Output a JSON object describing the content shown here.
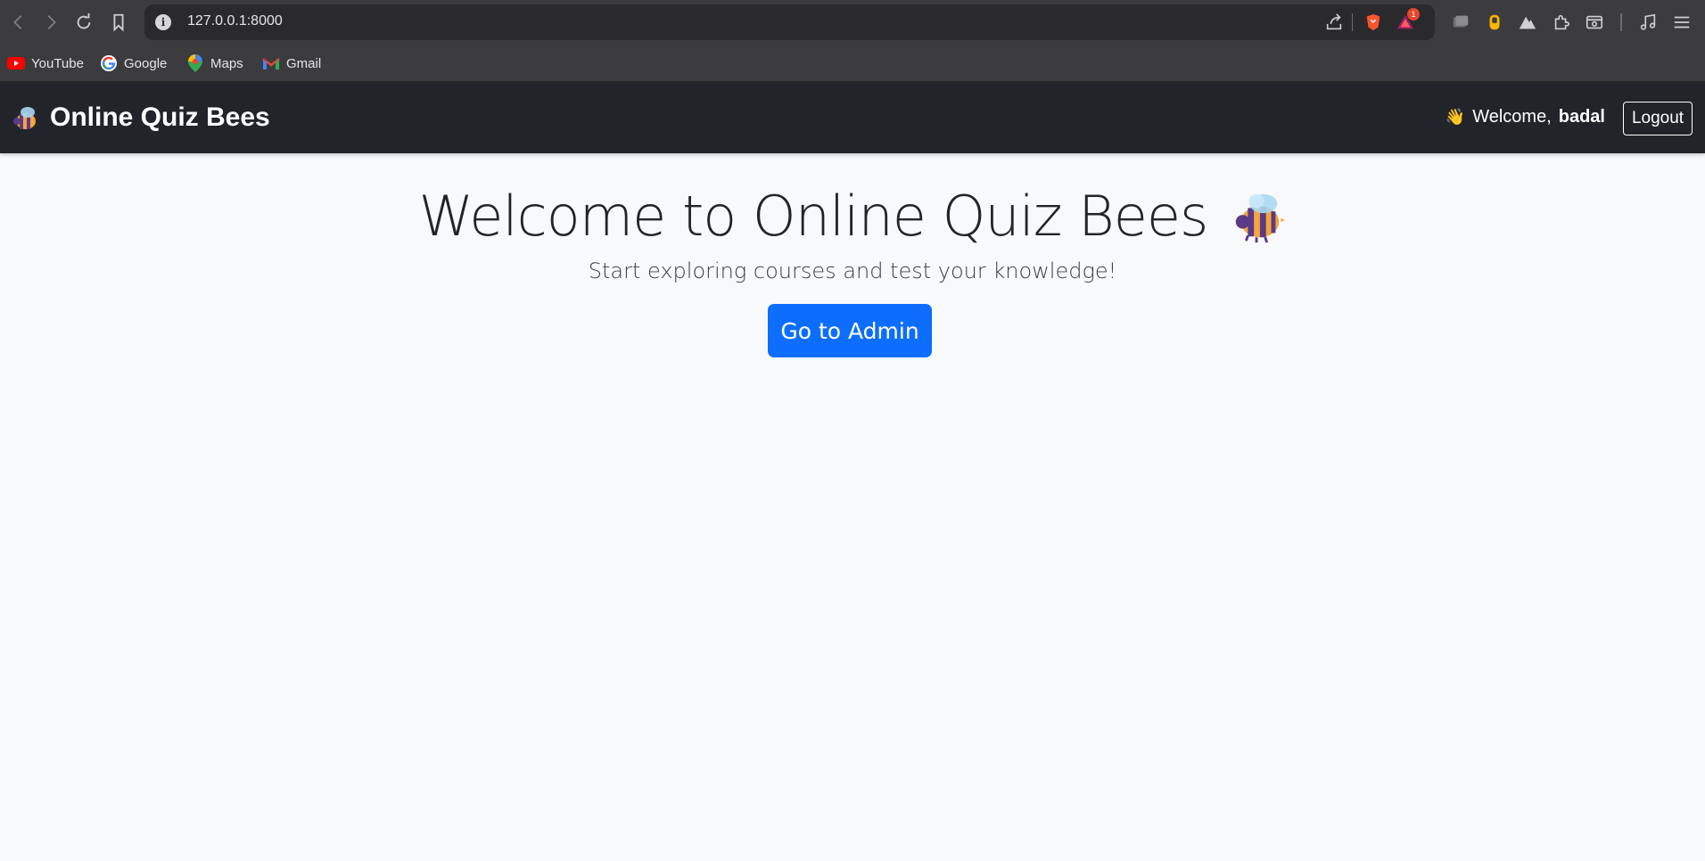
{
  "browser": {
    "url": "127.0.0.1:8000",
    "notification_count": "1",
    "bookmarks": [
      {
        "label": "YouTube",
        "icon": "youtube-icon"
      },
      {
        "label": "Google",
        "icon": "google-icon"
      },
      {
        "label": "Maps",
        "icon": "maps-icon"
      },
      {
        "label": "Gmail",
        "icon": "gmail-icon"
      }
    ]
  },
  "navbar": {
    "brand": "Online Quiz Bees",
    "welcome_prefix": "Welcome,",
    "username": "badal",
    "logout_label": "Logout"
  },
  "hero": {
    "title": "Welcome to Online Quiz Bees",
    "subtitle": "Start exploring courses and test your knowledge!",
    "admin_button": "Go to Admin"
  },
  "colors": {
    "primary": "#0d6efd",
    "navbar_bg": "#212529",
    "page_bg": "#f8f9fa"
  }
}
